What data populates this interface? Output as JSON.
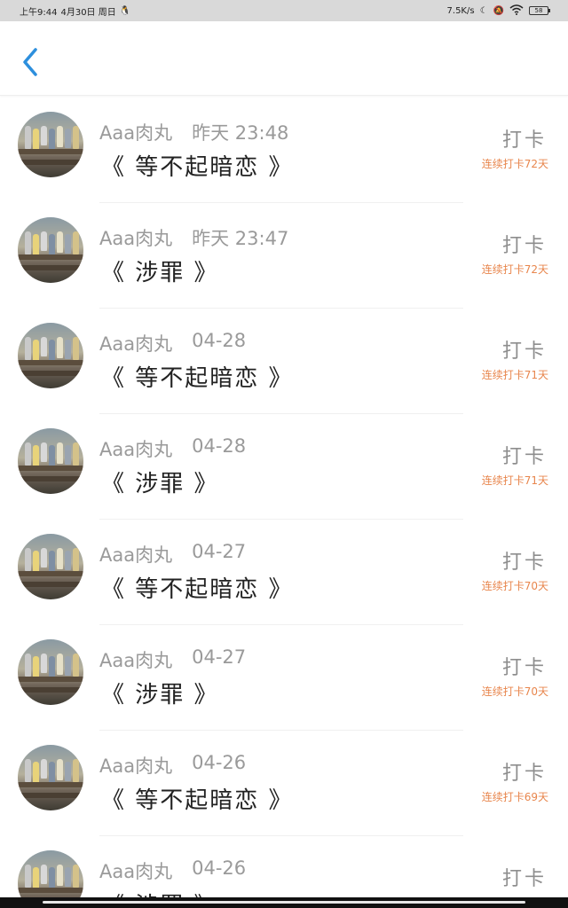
{
  "status_bar": {
    "time": "上午9:44",
    "date": "4月30日 周日",
    "speed": "7.5K/s",
    "battery": "58"
  },
  "items": [
    {
      "user": "Aaa肉丸",
      "time": "昨天 23:48",
      "title": "《 等不起暗恋 》",
      "checkin": "打卡",
      "streak": "连续打卡72天"
    },
    {
      "user": "Aaa肉丸",
      "time": "昨天 23:47",
      "title": "《 涉罪 》",
      "checkin": "打卡",
      "streak": "连续打卡72天"
    },
    {
      "user": "Aaa肉丸",
      "time": "04-28",
      "title": "《 等不起暗恋 》",
      "checkin": "打卡",
      "streak": "连续打卡71天"
    },
    {
      "user": "Aaa肉丸",
      "time": "04-28",
      "title": "《 涉罪 》",
      "checkin": "打卡",
      "streak": "连续打卡71天"
    },
    {
      "user": "Aaa肉丸",
      "time": "04-27",
      "title": "《 等不起暗恋 》",
      "checkin": "打卡",
      "streak": "连续打卡70天"
    },
    {
      "user": "Aaa肉丸",
      "time": "04-27",
      "title": "《 涉罪 》",
      "checkin": "打卡",
      "streak": "连续打卡70天"
    },
    {
      "user": "Aaa肉丸",
      "time": "04-26",
      "title": "《 等不起暗恋 》",
      "checkin": "打卡",
      "streak": "连续打卡69天"
    },
    {
      "user": "Aaa肉丸",
      "time": "04-26",
      "title": "《 涉罪 》",
      "checkin": "打卡",
      "streak": ""
    }
  ],
  "colors": {
    "accent": "#2d8fdd",
    "streak": "#e8864d"
  }
}
